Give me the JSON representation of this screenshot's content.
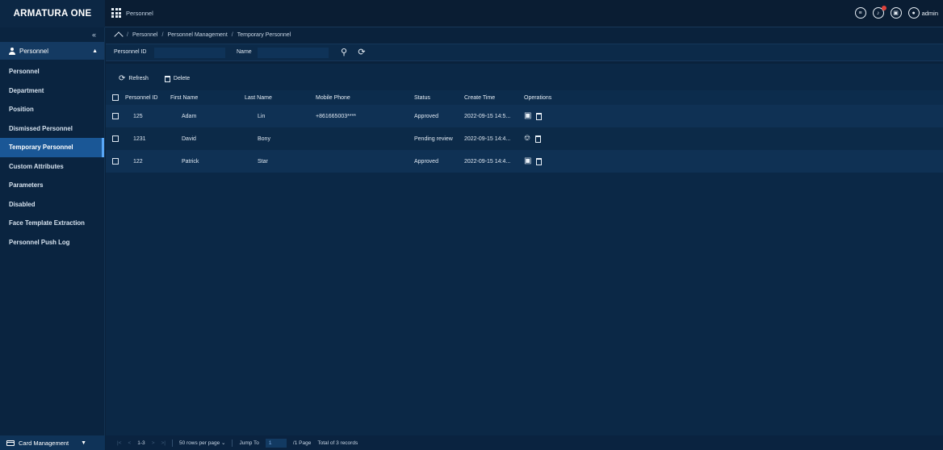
{
  "app": {
    "logo": "ARMATURA ONE",
    "module_tab": "Personnel",
    "user": "admin"
  },
  "sidebar": {
    "collapse_icon": "«",
    "module": "Personnel",
    "items": [
      "Personnel",
      "Department",
      "Position",
      "Dismissed Personnel",
      "Temporary Personnel",
      "Custom Attributes",
      "Parameters",
      "Disabled",
      "Face Template Extraction",
      "Personnel Push Log"
    ],
    "active_index": 4,
    "bottom_module": "Card Management"
  },
  "breadcrumb": [
    "Personnel",
    "Personnel Management",
    "Temporary Personnel"
  ],
  "search": {
    "personnel_id_label": "Personnel ID",
    "name_label": "Name"
  },
  "toolbar": {
    "refresh": "Refresh",
    "delete": "Delete"
  },
  "table": {
    "columns": [
      "Personnel ID",
      "First Name",
      "Last Name",
      "Mobile Phone",
      "Status",
      "Create Time",
      "Operations"
    ],
    "rows": [
      {
        "id": "125",
        "first": "Adam",
        "last": "Lin",
        "phone": "+861665003****",
        "status": "Approved",
        "created": "2022-09-15 14:5...",
        "op": "edit"
      },
      {
        "id": "1231",
        "first": "David",
        "last": "Bony",
        "phone": "",
        "status": "Pending review",
        "created": "2022-09-15 14:4...",
        "op": "review"
      },
      {
        "id": "122",
        "first": "Patrick",
        "last": "Star",
        "phone": "",
        "status": "Approved",
        "created": "2022-09-15 14:4...",
        "op": "edit"
      }
    ]
  },
  "pager": {
    "range": "1-3",
    "rows_per_page": "50 rows per page",
    "jump_label": "Jump To",
    "jump_value": "1",
    "pages": "/1 Page",
    "total": "Total of 3 records"
  },
  "colors": {
    "accent": "#1a5796",
    "notification": "#e0413a",
    "background": "#0a223c"
  }
}
